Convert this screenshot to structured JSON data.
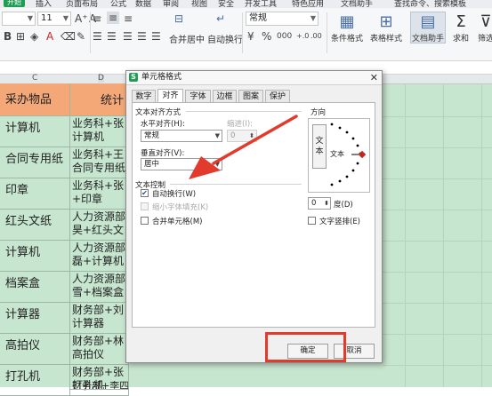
{
  "ribbon": {
    "menu": [
      "开始",
      "插入",
      "页面布局",
      "公式",
      "数据",
      "审阅",
      "视图",
      "安全",
      "开发工具",
      "特色应用",
      "文档助手",
      "查找命令、搜索模板"
    ],
    "font_size": "11",
    "numfmt": "常规",
    "merge_label": "合并居中",
    "wrap_label": "自动换行",
    "cond_format_label": "条件格式",
    "table_style_label": "表格样式",
    "doc_helper_label": "文档助手",
    "sum_label": "求和",
    "filter_label": "筛选"
  },
  "sheet": {
    "columns": [
      "C",
      "D"
    ],
    "header": {
      "c": "采办物品",
      "d": "统计"
    },
    "rows": [
      {
        "c": "计算机",
        "d": [
          "业务科+张",
          "计算机"
        ]
      },
      {
        "c": "合同专用纸",
        "d": [
          "业务科+王",
          "合同专用纸"
        ]
      },
      {
        "c": "印章",
        "d": [
          "业务科+张",
          "+印章"
        ]
      },
      {
        "c": "红头文纸",
        "d": [
          "人力资源部",
          "昊+红头文"
        ]
      },
      {
        "c": "计算机",
        "d": [
          "人力资源部",
          "磊+计算机"
        ]
      },
      {
        "c": "档案盒",
        "d": [
          "人力资源部",
          "雪+档案盒"
        ]
      },
      {
        "c": "计算器",
        "d": [
          "财务部+刘",
          "计算器"
        ]
      },
      {
        "c": "高拍仪",
        "d": [
          "财务部+林",
          "高拍仪"
        ]
      },
      {
        "c": "打孔机",
        "d": [
          "财务部+张",
          "打孔机"
        ]
      },
      {
        "c": "",
        "d": [
          "财务部+李四"
        ]
      }
    ]
  },
  "dialog": {
    "title": "单元格格式",
    "app_icon": "S",
    "tabs": [
      "数字",
      "对齐",
      "字体",
      "边框",
      "图案",
      "保护"
    ],
    "active_tab": "对齐",
    "text_align_section": "文本对齐方式",
    "horizontal_label": "水平对齐(H):",
    "horizontal_value": "常规",
    "indent_label": "缩进(I):",
    "indent_value": "0",
    "vertical_label": "垂直对齐(V):",
    "vertical_value": "居中",
    "text_control_section": "文本控制",
    "wrap_text_label": "自动换行(W)",
    "wrap_text_checked": true,
    "shrink_label": "缩小字体填充(K)",
    "merge_cells_label": "合并单元格(M)",
    "orientation_section": "方向",
    "vertical_text_label": "文本",
    "orient_text": "文本",
    "degree_value": "0",
    "degree_label": "度(D)",
    "vertical_arrange_label": "文字竖排(E)",
    "ok_label": "确定",
    "cancel_label": "取消"
  },
  "colors": {
    "sheet_green": "#c7e6cf",
    "header_orange": "#f4a878",
    "highlight_red": "#e23a2d",
    "brand_green": "#1f9d55"
  }
}
